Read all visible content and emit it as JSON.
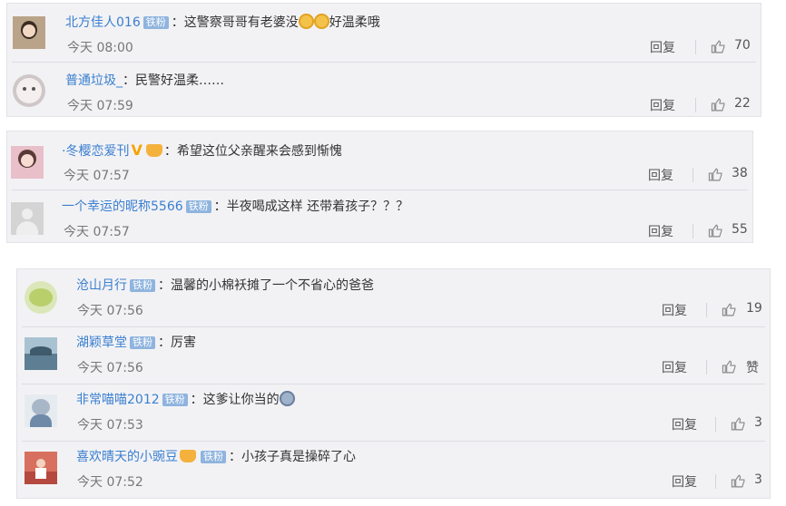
{
  "groups": [
    {
      "comments": [
        {
          "user": "北方佳人016",
          "badges": [
            "铁粉"
          ],
          "text": "：这警察哥哥有老婆没",
          "emoji": "laugh-cry-emoji",
          "emoji2": "laugh-cry-emoji",
          "text_after": "好温柔哦",
          "time": "今天 08:00",
          "reply_label": "回复",
          "likes": "70",
          "avatar_color": "#b9a48a"
        },
        {
          "user": "普通垃圾_",
          "badges": [],
          "text": "：民警好温柔……",
          "time": "今天 07:59",
          "reply_label": "回复",
          "likes": "22",
          "avatar_color": "#cfc7c7"
        }
      ]
    },
    {
      "comments": [
        {
          "user": "·冬樱恋爱刊",
          "vip": "V",
          "crown": true,
          "text": "：希望这位父亲醒来会感到惭愧",
          "time": "今天 07:57",
          "reply_label": "回复",
          "likes": "38",
          "avatar_color": "#e9bfc9"
        },
        {
          "user": "一个幸运的昵称5566",
          "badges": [
            "铁粉"
          ],
          "text": "：半夜喝成这样 还带着孩子？？？",
          "time": "今天 07:57",
          "reply_label": "回复",
          "likes": "55",
          "avatar_color": "#d4d4d4"
        }
      ]
    },
    {
      "comments": [
        {
          "user": "沧山月行",
          "badges": [
            "铁粉"
          ],
          "text": "：温馨的小棉袄摊了一个不省心的爸爸",
          "time": "今天 07:56",
          "reply_label": "回复",
          "likes": "19",
          "avatar_color": "#b8cf6c"
        },
        {
          "user": "湖颖草堂",
          "badges": [
            "铁粉"
          ],
          "text": "：厉害",
          "time": "今天 07:56",
          "reply_label": "回复",
          "likes": "赞",
          "avatar_color": "#5d7e93"
        },
        {
          "user": "非常喵喵2012",
          "badges": [
            "铁粉"
          ],
          "text": "：这爹让你当的",
          "emoji": "dizzy-face-emoji",
          "time": "今天 07:53",
          "reply_label": "回复",
          "likes": "3",
          "avatar_color": "#a8b7c8"
        },
        {
          "user": "喜欢晴天的小豌豆",
          "crown": true,
          "badges": [
            "铁粉"
          ],
          "text": "：小孩子真是操碎了心",
          "time": "今天 07:52",
          "reply_label": "回复",
          "likes": "3",
          "avatar_color": "#b5493f"
        }
      ]
    }
  ],
  "colors": {
    "username": "#3a7fd0",
    "badge": "#8fb4de",
    "panel": "#f2f2f5"
  }
}
